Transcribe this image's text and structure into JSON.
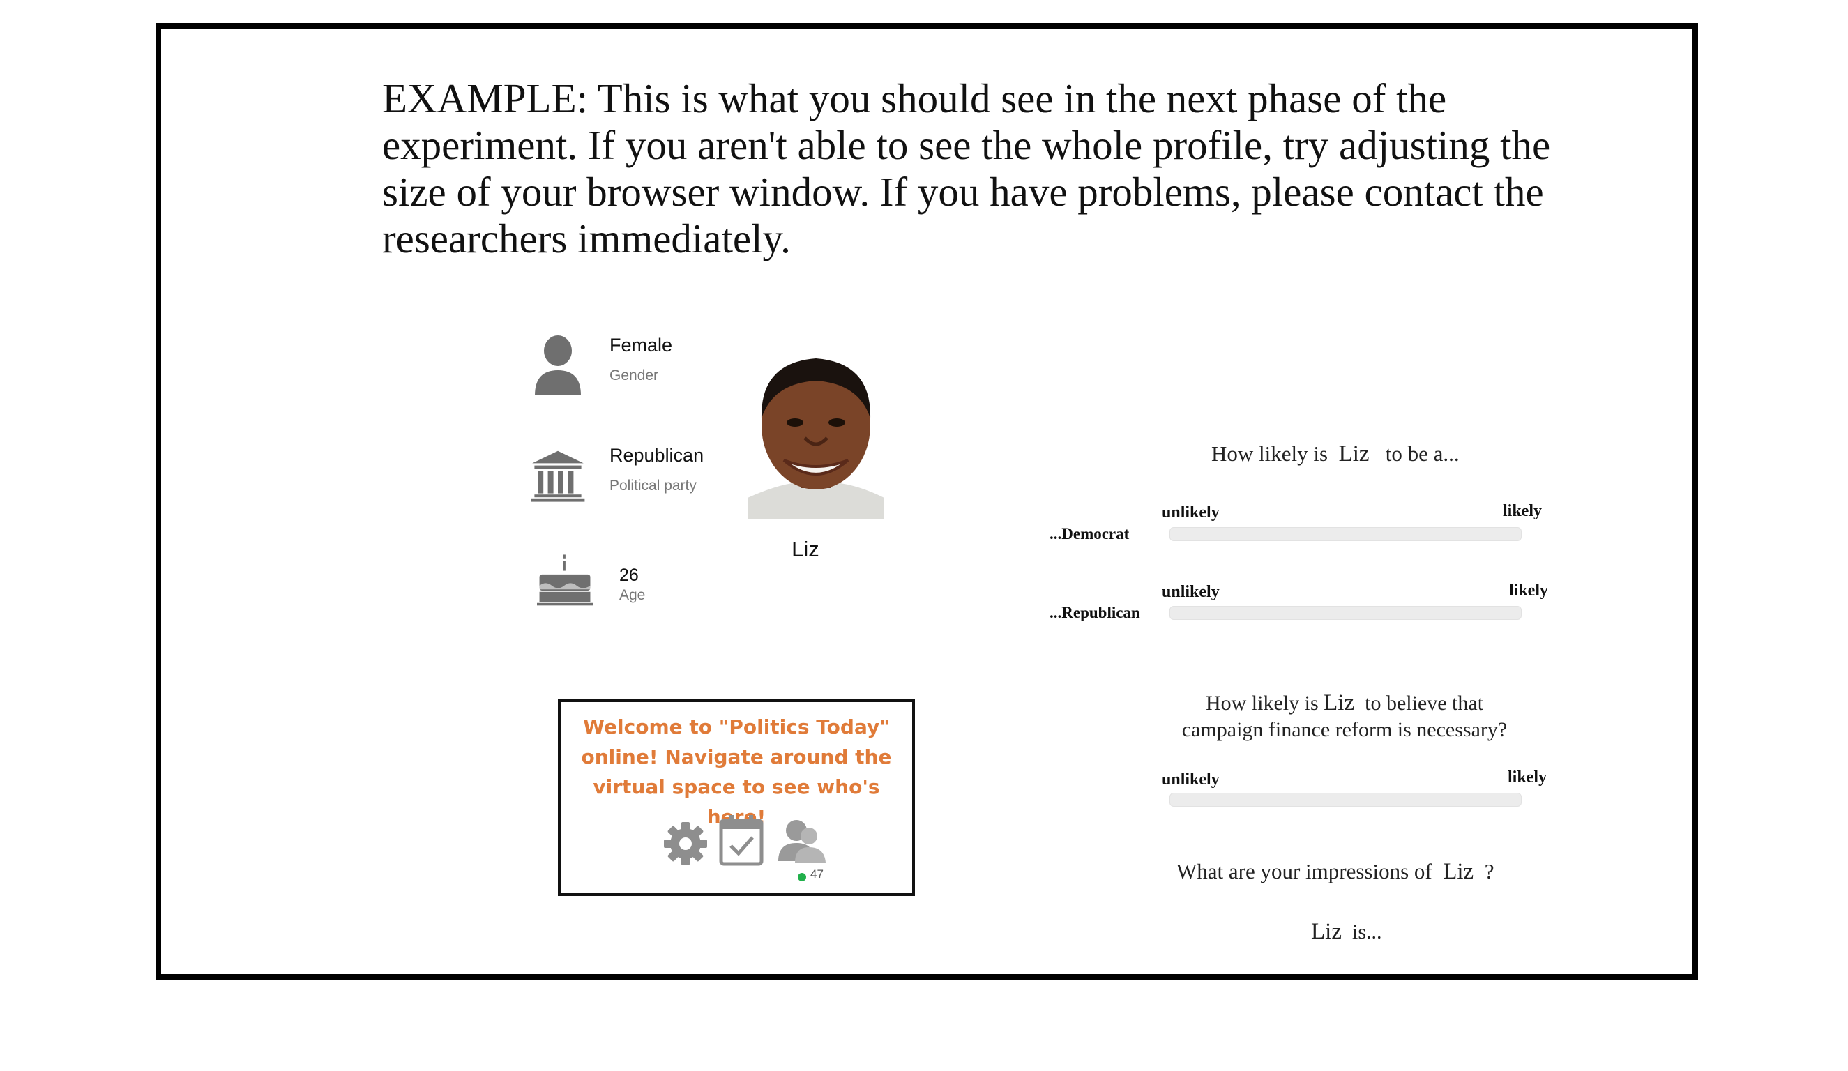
{
  "instructions": "EXAMPLE: This is what you should see in the next phase of the experiment. If you aren't able to see the whole profile, try adjusting the size of your browser window.  If you have problems, please contact the researchers immediately.",
  "profile": {
    "name": "Liz",
    "attributes": {
      "gender": {
        "value": "Female",
        "label": "Gender",
        "icon": "person-icon"
      },
      "party": {
        "value": "Republican",
        "label": "Political party",
        "icon": "government-building-icon"
      },
      "age": {
        "value": "26",
        "label": "Age",
        "icon": "birthday-cake-icon"
      }
    }
  },
  "banner": {
    "text": "Welcome to \"Politics Today\" online! Navigate around the virtual space to see who's here!",
    "online_count": "47",
    "accent_color": "#e07b39",
    "icons": [
      "gear-icon",
      "calendar-check-icon",
      "users-icon"
    ]
  },
  "survey": {
    "q1": {
      "prefix": "How likely is",
      "name": "Liz",
      "suffix": "to be a..."
    },
    "rows": [
      {
        "label": "...Democrat",
        "low": "unlikely",
        "high": "likely"
      },
      {
        "label": "...Republican",
        "low": "unlikely",
        "high": "likely"
      }
    ],
    "q2": {
      "prefix": "How likely is",
      "name": "Liz",
      "suffix": "to believe that campaign finance reform is necessary?",
      "low": "unlikely",
      "high": "likely"
    },
    "q3": {
      "prefix": "What are your impressions of",
      "name": "Liz",
      "suffix": "?"
    },
    "liz_is": {
      "name": "Liz",
      "suffix": "is..."
    }
  }
}
